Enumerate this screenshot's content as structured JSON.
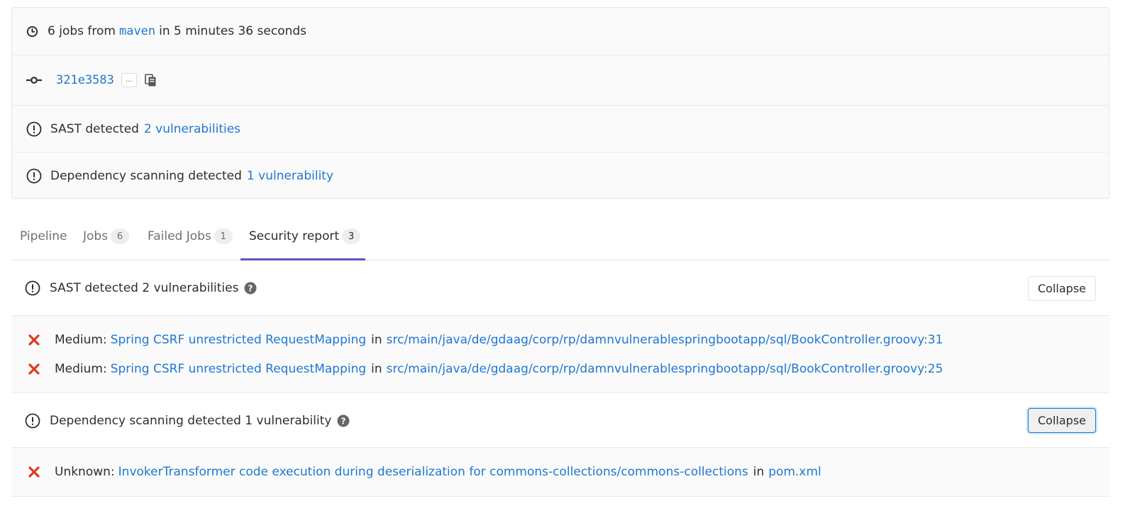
{
  "pipeline_info": {
    "jobs_prefix": "6 jobs from",
    "branch": "maven",
    "duration_text": "in 5 minutes 36 seconds",
    "commit_sha": "321e3583",
    "commit_ellipsis": "...",
    "sast_prefix": "SAST detected",
    "sast_link": "2 vulnerabilities",
    "dep_prefix": "Dependency scanning detected",
    "dep_link": "1 vulnerability"
  },
  "tabs": [
    {
      "label": "Pipeline",
      "count": null
    },
    {
      "label": "Jobs",
      "count": "6"
    },
    {
      "label": "Failed Jobs",
      "count": "1"
    },
    {
      "label": "Security report",
      "count": "3",
      "active": true
    }
  ],
  "sast_section": {
    "title": "SAST detected 2 vulnerabilities",
    "collapse_label": "Collapse",
    "findings": [
      {
        "severity": "Medium:",
        "title": "Spring CSRF unrestricted RequestMapping",
        "in_text": "in",
        "file": "src/main/java/de/gdaag/corp/rp/damnvulnerablespringbootapp/sql/BookController.groovy:31"
      },
      {
        "severity": "Medium:",
        "title": "Spring CSRF unrestricted RequestMapping",
        "in_text": "in",
        "file": "src/main/java/de/gdaag/corp/rp/damnvulnerablespringbootapp/sql/BookController.groovy:25"
      }
    ]
  },
  "dep_section": {
    "title": "Dependency scanning detected 1 vulnerability",
    "collapse_label": "Collapse",
    "findings": [
      {
        "severity": "Unknown:",
        "title": "InvokerTransformer code execution during deserialization for commons-collections/commons-collections",
        "in_text": "in",
        "file": "pom.xml"
      }
    ]
  },
  "colors": {
    "link": "#1f78d1",
    "active_tab_underline": "#6b4fbb",
    "error_icon": "#db3b21"
  }
}
